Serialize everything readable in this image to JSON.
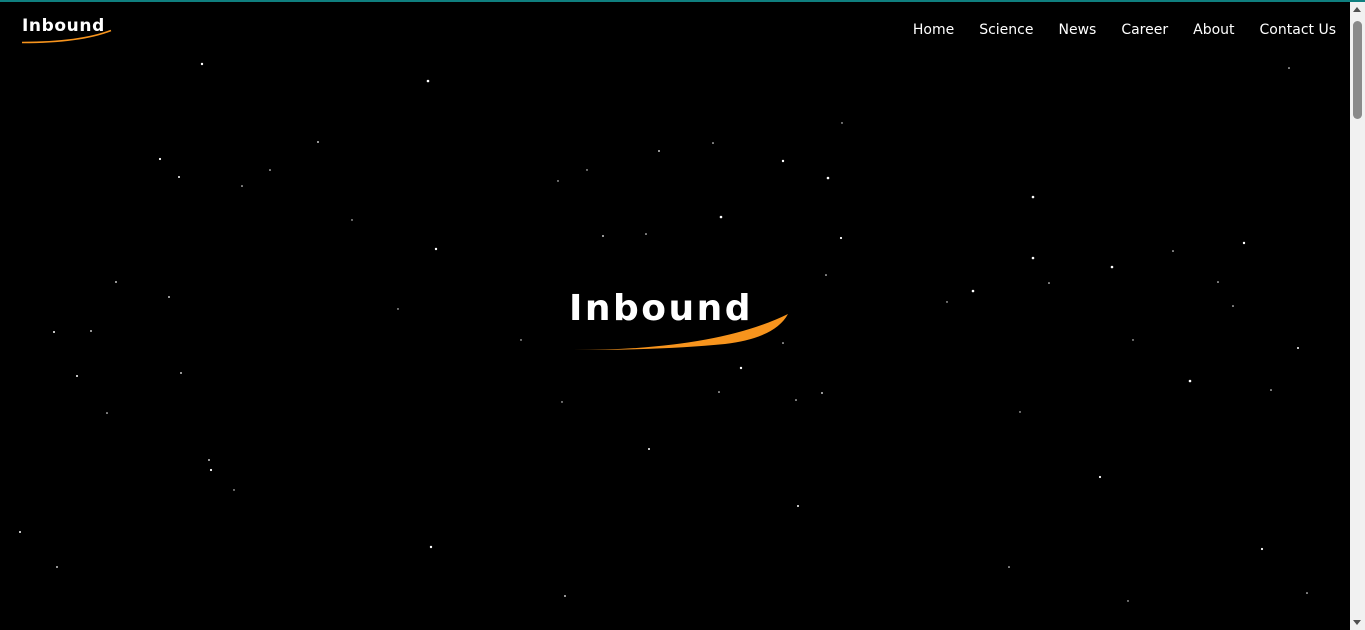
{
  "colors": {
    "background": "#000000",
    "accent": "#0f7f7f",
    "logo_text": "#ffffff",
    "logo_swoosh": "#f7941d",
    "star": "#ffffff"
  },
  "header": {
    "logo_text": "Inbound"
  },
  "nav": {
    "items": [
      {
        "label": "Home"
      },
      {
        "label": "Science"
      },
      {
        "label": "News"
      },
      {
        "label": "Career"
      },
      {
        "label": "About"
      },
      {
        "label": "Contact Us"
      }
    ]
  },
  "hero": {
    "logo_text": "Inbound"
  },
  "icons": {
    "scroll_up": "triangle-up",
    "scroll_down": "triangle-down"
  }
}
